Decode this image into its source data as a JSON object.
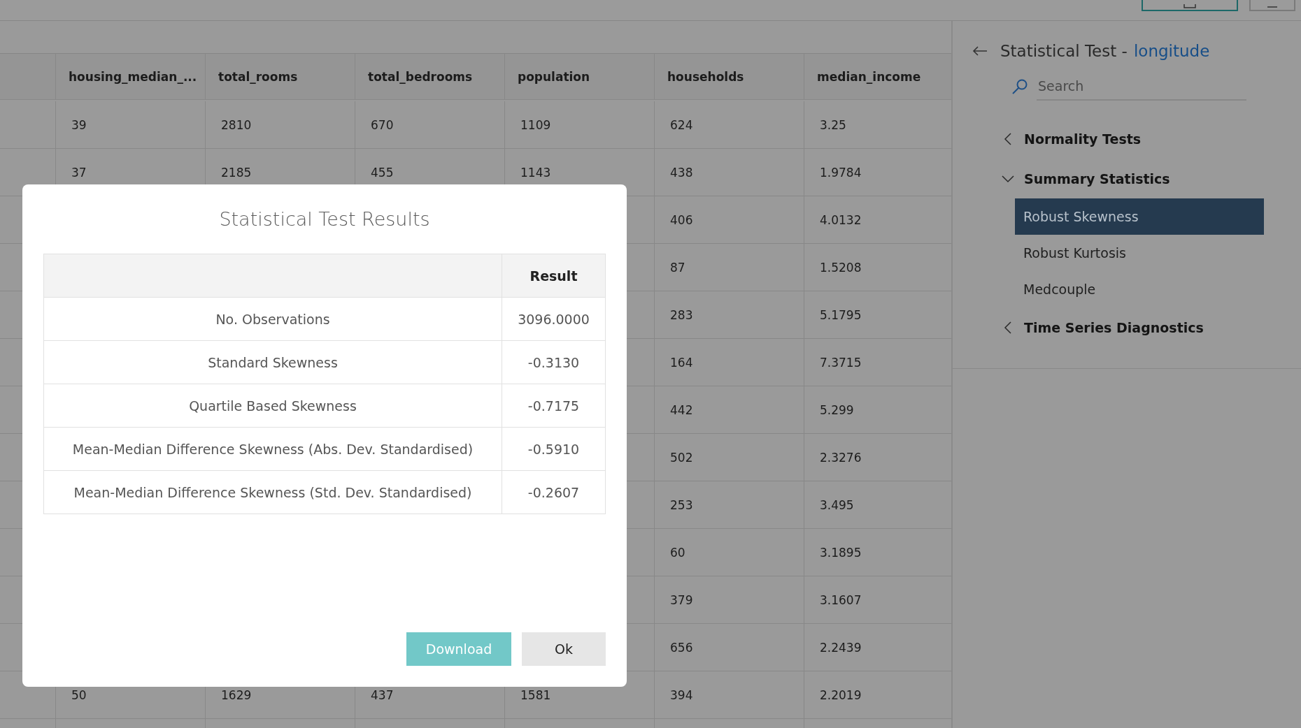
{
  "table": {
    "columns": [
      "housing_median_...",
      "total_rooms",
      "total_bedrooms",
      "population",
      "households",
      "median_income"
    ],
    "rows": [
      [
        "39",
        "2810",
        "670",
        "1109",
        "624",
        "3.25"
      ],
      [
        "37",
        "2185",
        "455",
        "1143",
        "438",
        "1.9784"
      ],
      [
        null,
        null,
        null,
        null,
        "406",
        "4.0132"
      ],
      [
        null,
        null,
        null,
        null,
        "87",
        "1.5208"
      ],
      [
        null,
        null,
        null,
        null,
        "283",
        "5.1795"
      ],
      [
        null,
        null,
        null,
        null,
        "164",
        "7.3715"
      ],
      [
        null,
        null,
        null,
        null,
        "442",
        "5.299"
      ],
      [
        null,
        null,
        null,
        null,
        "502",
        "2.3276"
      ],
      [
        null,
        null,
        null,
        null,
        "253",
        "3.495"
      ],
      [
        null,
        null,
        null,
        null,
        "60",
        "3.1895"
      ],
      [
        null,
        null,
        null,
        null,
        "379",
        "3.1607"
      ],
      [
        null,
        null,
        null,
        null,
        "656",
        "2.2439"
      ],
      [
        "50",
        "1629",
        "437",
        "1581",
        "394",
        "2.2019"
      ]
    ]
  },
  "dialog": {
    "title": "Statistical Test Results",
    "result_header": "Result",
    "rows": [
      {
        "label": "No. Observations",
        "result": "3096.0000"
      },
      {
        "label": "Standard Skewness",
        "result": "-0.3130"
      },
      {
        "label": "Quartile Based Skewness",
        "result": "-0.7175"
      },
      {
        "label": "Mean-Median Difference Skewness (Abs. Dev. Standardised)",
        "result": "-0.5910"
      },
      {
        "label": "Mean-Median Difference Skewness (Std. Dev. Standardised)",
        "result": "-0.2607"
      }
    ],
    "buttons": [
      {
        "label": "Download",
        "kind": "primary"
      },
      {
        "label": "Ok",
        "kind": "secondary"
      }
    ]
  },
  "panel": {
    "title": "Statistical Test -",
    "subject": "longitude",
    "search": {
      "placeholder": "Search"
    },
    "tree": [
      {
        "label": "Normality Tests",
        "expanded": false
      },
      {
        "label": "Summary Statistics",
        "expanded": true,
        "children": [
          {
            "label": "Robust Skewness",
            "selected": true
          },
          {
            "label": "Robust Kurtosis",
            "selected": false
          },
          {
            "label": "Medcouple",
            "selected": false
          }
        ]
      },
      {
        "label": "Time Series Diagnostics",
        "expanded": false
      }
    ]
  }
}
